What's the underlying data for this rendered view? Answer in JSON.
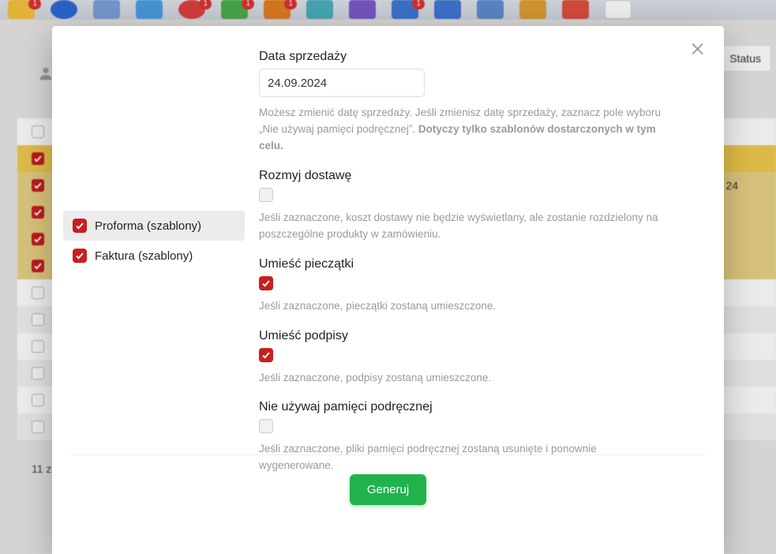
{
  "background": {
    "status_button": "Status",
    "row_right_value": "24",
    "footer_count": "11 z"
  },
  "modal": {
    "close": "✕",
    "templates": [
      {
        "label": "Proforma (szablony)",
        "checked": true,
        "active": true
      },
      {
        "label": "Faktura (szablony)",
        "checked": true,
        "active": false
      }
    ],
    "sale_date": {
      "label": "Data sprzedaży",
      "value": "24.09.2024",
      "help_1": "Możesz zmienić datę sprzedaży. Jeśli zmienisz datę sprzedaży, zaznacz pole wyboru „Nie używaj pamięci podręcznej”. ",
      "help_strong": "Dotyczy tylko szablonów dostarczonych w tym celu."
    },
    "blur_delivery": {
      "label": "Rozmyj dostawę",
      "checked": false,
      "help": "Jeśli zaznaczone, koszt dostawy nie będzie wyświetlany, ale zostanie rozdzielony na poszczególne produkty w zamówieniu."
    },
    "place_stamps": {
      "label": "Umieść pieczątki",
      "checked": true,
      "help": "Jeśli zaznaczone, pieczątki zostaną umieszczone."
    },
    "place_signatures": {
      "label": "Umieść podpisy",
      "checked": true,
      "help": "Jeśli zaznaczone, podpisy zostaną umieszczone."
    },
    "no_cache": {
      "label": "Nie używaj pamięci podręcznej",
      "checked": false,
      "help": "Jeśli zaznaczone, pliki pamięci podręcznej zostaną usunięte i ponownie wygenerowane."
    },
    "generate_button": "Generuj"
  }
}
